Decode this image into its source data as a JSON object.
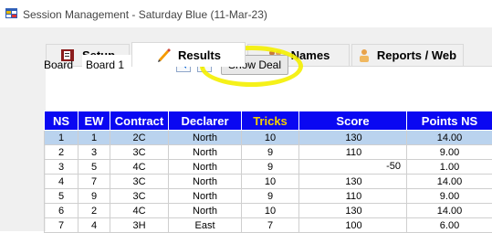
{
  "window": {
    "title": "Session Management - Saturday Blue (11-Mar-23)",
    "icon": "app-window-icon"
  },
  "tabs": [
    {
      "label": "Setup",
      "icon": "setup-book-icon",
      "active": false
    },
    {
      "label": "Results",
      "icon": "pencil-icon",
      "active": true
    },
    {
      "label": "Names",
      "icon": "people-icon",
      "active": false
    },
    {
      "label": "Reports / Web",
      "icon": "report-person-icon",
      "active": false
    }
  ],
  "board": {
    "label": "Board",
    "selected": "Board 1"
  },
  "nav": {
    "prev_icon": "triangle-left-icon",
    "next_icon": "triangle-right-icon"
  },
  "show_deal_label": "Show Deal",
  "colors": {
    "header_bg": "#0a08f2",
    "header_fg": "#ffffff",
    "tricks_header": "#f5d000",
    "selected_row": "#bad3ee",
    "highlight_ring": "#f4f000"
  },
  "grid": {
    "columns": [
      "NS",
      "EW",
      "Contract",
      "Declarer",
      "Tricks",
      "Score",
      "Points NS"
    ],
    "rows": [
      {
        "ns": "1",
        "ew": "1",
        "contract": "2C",
        "declarer": "North",
        "tricks": "10",
        "score_pos": "130",
        "score_neg": "",
        "points": "14.00",
        "selected": true
      },
      {
        "ns": "2",
        "ew": "3",
        "contract": "3C",
        "declarer": "North",
        "tricks": "9",
        "score_pos": "110",
        "score_neg": "",
        "points": "9.00"
      },
      {
        "ns": "3",
        "ew": "5",
        "contract": "4C",
        "declarer": "North",
        "tricks": "9",
        "score_pos": "",
        "score_neg": "-50",
        "points": "1.00"
      },
      {
        "ns": "4",
        "ew": "7",
        "contract": "3C",
        "declarer": "North",
        "tricks": "10",
        "score_pos": "130",
        "score_neg": "",
        "points": "14.00"
      },
      {
        "ns": "5",
        "ew": "9",
        "contract": "3C",
        "declarer": "North",
        "tricks": "9",
        "score_pos": "110",
        "score_neg": "",
        "points": "9.00"
      },
      {
        "ns": "6",
        "ew": "2",
        "contract": "4C",
        "declarer": "North",
        "tricks": "10",
        "score_pos": "130",
        "score_neg": "",
        "points": "14.00"
      },
      {
        "ns": "7",
        "ew": "4",
        "contract": "3H",
        "declarer": "East",
        "tricks": "7",
        "score_pos": "100",
        "score_neg": "",
        "points": "6.00"
      }
    ]
  }
}
